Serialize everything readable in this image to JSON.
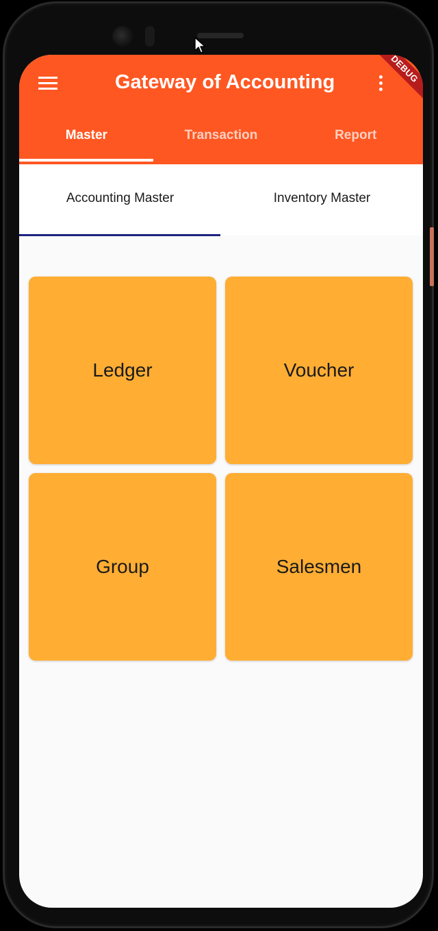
{
  "app": {
    "title": "Gateway of Accounting",
    "debug_banner": "DEBUG",
    "accent_color": "#ff5722",
    "tile_color": "#ffad33"
  },
  "tabs": [
    {
      "label": "Master",
      "active": true
    },
    {
      "label": "Transaction",
      "active": false
    },
    {
      "label": "Report",
      "active": false
    }
  ],
  "subtabs": [
    {
      "label": "Accounting Master",
      "active": true
    },
    {
      "label": "Inventory Master",
      "active": false
    }
  ],
  "tiles": [
    {
      "label": "Ledger"
    },
    {
      "label": "Voucher"
    },
    {
      "label": "Group"
    },
    {
      "label": "Salesmen"
    }
  ],
  "icons": {
    "menu": "menu-icon",
    "more": "more-vert-icon"
  }
}
